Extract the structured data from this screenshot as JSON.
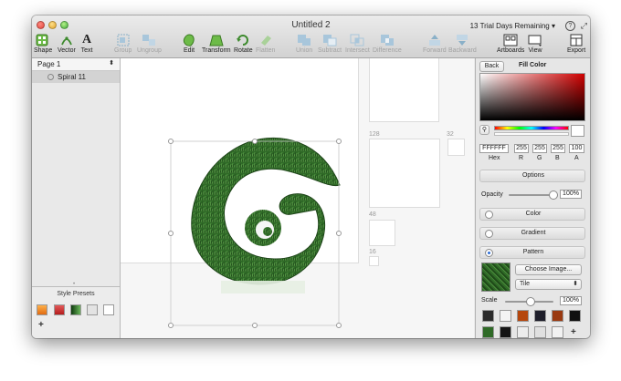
{
  "window": {
    "title": "Untitled 2",
    "trial_text": "13 Trial Days Remaining ▾"
  },
  "toolbar": {
    "shape": "Shape",
    "vector": "Vector",
    "text": "Text",
    "group": "Group",
    "ungroup": "Ungroup",
    "edit": "Edit",
    "transform": "Transform",
    "rotate": "Rotate",
    "flatten": "Flatten",
    "union": "Union",
    "subtract": "Subtract",
    "intersect": "Intersect",
    "difference": "Difference",
    "forward": "Forward",
    "backward": "Backward",
    "artboards": "Artboards",
    "view": "View",
    "export": "Export"
  },
  "sidebar": {
    "page": "Page 1",
    "layers": [
      {
        "name": "Spiral 11"
      }
    ],
    "presets_title": "Style Presets",
    "presets_add": "+"
  },
  "canvas": {
    "artboard_labels": [
      "128",
      "32",
      "48",
      "16"
    ]
  },
  "inspector": {
    "back": "Back",
    "title": "Fill Color",
    "hex": "FFFFFF",
    "r": "255",
    "g": "255",
    "b": "255",
    "a": "100",
    "labels": {
      "hex": "Hex",
      "r": "R",
      "g": "G",
      "b": "B",
      "a": "A"
    },
    "options": "Options",
    "opacity_label": "Opacity",
    "opacity_value": "100%",
    "color_tab": "Color",
    "gradient_tab": "Gradient",
    "pattern_tab": "Pattern",
    "choose_image": "Choose Image...",
    "mode": "Tile",
    "scale_label": "Scale",
    "scale_value": "100%",
    "add": "+"
  }
}
